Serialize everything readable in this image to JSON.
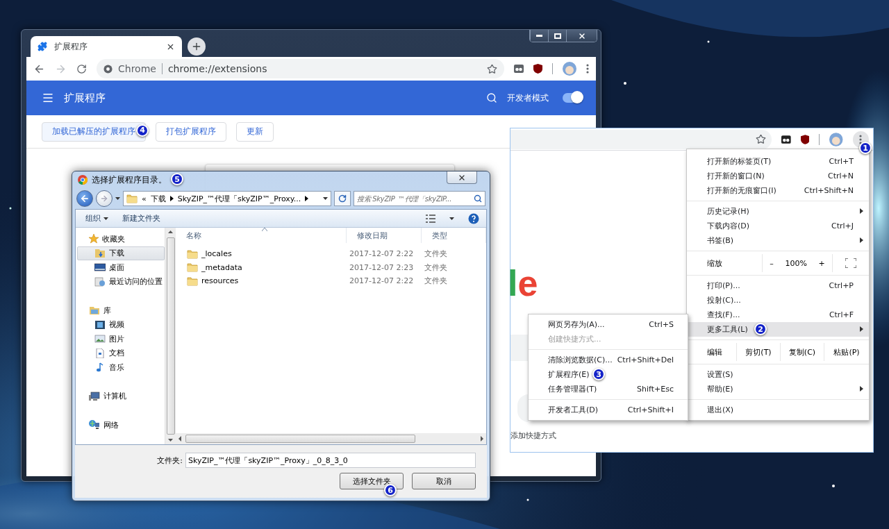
{
  "browser_main": {
    "tab_title": "扩展程序",
    "omnibox": {
      "site": "Chrome",
      "url": "chrome://extensions"
    },
    "header_title": "扩展程序",
    "dev_mode": {
      "label": "开发者模式",
      "on": true
    },
    "actions": [
      {
        "label": "加载已解压的扩展程序",
        "badge": "4"
      },
      {
        "label": "打包扩展程序"
      },
      {
        "label": "更新"
      }
    ]
  },
  "file_dialog": {
    "title": "选择扩展程序目录。",
    "badge": "5",
    "breadcrumb": [
      "«",
      "下载",
      "SkyZIP_™代理「skyZIP™_Proxy..."
    ],
    "search": {
      "placeholder": "搜索 SkyZIP_™代理「skyZIP..."
    },
    "toolbar": {
      "organize": "组织",
      "new_folder": "新建文件夹"
    },
    "nav": [
      {
        "label": "收藏夹",
        "children": [
          {
            "label": "下载",
            "selected": true
          },
          {
            "label": "桌面",
            "selected": false
          },
          {
            "label": "最近访问的位置",
            "selected": false
          }
        ]
      },
      {
        "label": "库",
        "children": [
          {
            "label": "视频",
            "selected": false
          },
          {
            "label": "图片",
            "selected": false
          },
          {
            "label": "文档",
            "selected": false
          },
          {
            "label": "音乐",
            "selected": false
          }
        ]
      },
      {
        "label": "计算机"
      },
      {
        "label": "网络"
      }
    ],
    "columns": [
      "名称",
      "修改日期",
      "类型"
    ],
    "rows": [
      {
        "name": "_locales",
        "date": "2017-12-07 2:22",
        "type": "文件夹"
      },
      {
        "name": "_metadata",
        "date": "2017-12-07 2:23",
        "type": "文件夹"
      },
      {
        "name": "resources",
        "date": "2017-12-07 2:22",
        "type": "文件夹"
      }
    ],
    "folder_field": {
      "label": "文件夹:",
      "value": "SkyZIP_™代理「skyZIP™_Proxy」_0_8_3_0"
    },
    "buttons": [
      {
        "label": "选择文件夹",
        "badge": "6"
      },
      {
        "label": "取消"
      }
    ]
  },
  "browser_second": {
    "menu_badge": "1",
    "logo_fragment": "le",
    "shortcut_label": "添加快捷方式",
    "menu": [
      {
        "kind": "item",
        "label": "打开新的标签页(T)",
        "shortcut": "Ctrl+T",
        "has_submenu": false,
        "highlighted": false
      },
      {
        "kind": "item",
        "label": "打开新的窗口(N)",
        "shortcut": "Ctrl+N",
        "has_submenu": false,
        "highlighted": false
      },
      {
        "kind": "item",
        "label": "打开新的无痕窗口(I)",
        "shortcut": "Ctrl+Shift+N",
        "has_submenu": false,
        "highlighted": false
      },
      {
        "kind": "separator"
      },
      {
        "kind": "item",
        "label": "历史记录(H)",
        "has_submenu": true,
        "highlighted": false
      },
      {
        "kind": "item",
        "label": "下载内容(D)",
        "shortcut": "Ctrl+J",
        "has_submenu": false,
        "highlighted": false
      },
      {
        "kind": "item",
        "label": "书签(B)",
        "has_submenu": true,
        "highlighted": false
      },
      {
        "kind": "separator"
      },
      {
        "kind": "zoom",
        "label": "缩放",
        "minus": "–",
        "value": "100%",
        "plus": "+"
      },
      {
        "kind": "separator"
      },
      {
        "kind": "item",
        "label": "打印(P)...",
        "shortcut": "Ctrl+P",
        "has_submenu": false,
        "highlighted": false
      },
      {
        "kind": "item",
        "label": "投射(C)...",
        "has_submenu": false,
        "highlighted": false
      },
      {
        "kind": "item",
        "label": "查找(F)...",
        "shortcut": "Ctrl+F",
        "has_submenu": false,
        "highlighted": false
      },
      {
        "kind": "item",
        "label": "更多工具(L)",
        "has_submenu": true,
        "highlighted": true,
        "badge": "2"
      },
      {
        "kind": "separator"
      },
      {
        "kind": "edit",
        "label": "编辑",
        "buttons": [
          "剪切(T)",
          "复制(C)",
          "粘贴(P)"
        ]
      },
      {
        "kind": "separator"
      },
      {
        "kind": "item",
        "label": "设置(S)",
        "has_submenu": false,
        "highlighted": false
      },
      {
        "kind": "item",
        "label": "帮助(E)",
        "has_submenu": true,
        "highlighted": false
      },
      {
        "kind": "separator"
      },
      {
        "kind": "item",
        "label": "退出(X)",
        "has_submenu": false,
        "highlighted": false
      }
    ],
    "submenu": [
      {
        "kind": "item",
        "label": "网页另存为(A)...",
        "shortcut": "Ctrl+S",
        "disabled": false
      },
      {
        "kind": "item",
        "label": "创建快捷方式...",
        "disabled": true
      },
      {
        "kind": "separator"
      },
      {
        "kind": "item",
        "label": "清除浏览数据(C)...",
        "shortcut": "Ctrl+Shift+Del",
        "disabled": false
      },
      {
        "kind": "item",
        "label": "扩展程序(E)",
        "disabled": false,
        "badge": "3"
      },
      {
        "kind": "item",
        "label": "任务管理器(T)",
        "shortcut": "Shift+Esc",
        "disabled": false
      },
      {
        "kind": "separator"
      },
      {
        "kind": "item",
        "label": "开发者工具(D)",
        "shortcut": "Ctrl+Shift+I",
        "disabled": false
      }
    ]
  }
}
